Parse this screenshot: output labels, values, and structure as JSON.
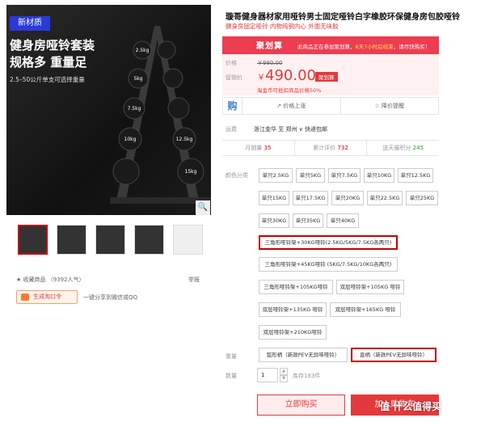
{
  "hero": {
    "badge": "新材质",
    "title": "健身房哑铃套装 规格多 重量足",
    "subtitle": "2.5–50公斤单支可选择重量",
    "dumbbell_labels": [
      "2.5kg",
      "5kg",
      "7.5kg",
      "10kg",
      "12.5kg",
      "15kg"
    ]
  },
  "actions": {
    "favorite": "收藏商品 （9392人气）",
    "report": "举报",
    "share_button": "生成淘口令",
    "share_text": "一键分享到微信或QQ"
  },
  "product": {
    "title": "璇哥健身器材家用哑铃男士固定哑铃白字橡胶环保健身房包胶哑铃",
    "subtitle": "健身房固定哑铃 内物纯钢内心 外面无味胶"
  },
  "promo": {
    "logo": "聚划算",
    "text_prefix": "此商品正在参加聚划算，",
    "text_highlight": "6天7小时后结束",
    "text_suffix": "，请尽快购买！"
  },
  "price": {
    "orig_label": "价格",
    "orig_value": "￥980.00",
    "promo_label": "促销价",
    "currency": "￥",
    "promo_value": "490.00",
    "promo_tag": "聚划算",
    "note": "淘金币可抵扣商品价格50%"
  },
  "tools": {
    "buy_icon": "购",
    "price_alert": "价格上涨",
    "price_drop": "降价提醒"
  },
  "shipping": {
    "label": "运费",
    "text": "浙江金华 至 郑州 ∨ 快递包邮"
  },
  "stats": {
    "monthly_label": "月销量",
    "monthly_value": "35",
    "reviews_label": "累计评价",
    "reviews_value": "732",
    "points_label": "送天猫积分",
    "points_value": "245"
  },
  "color": {
    "label": "颜色分类",
    "options": [
      "单只2.5KG",
      "单只5KG",
      "单只7.5KG",
      "单只10KG",
      "单只12.5KG",
      "单只15KG",
      "单只17.5KG",
      "单只20KG",
      "单只22.5KG",
      "单只25KG",
      "单只30KG",
      "单只35KG",
      "单只40KG",
      "三角形哑铃架+30KG哑铃(2.5KG/5KG/7.5KG各两只)",
      "三角形哑铃架+45KG哑铃 (5KG/7.5KG/10KG各两只)",
      "三角形哑铃架+105KG哑铃",
      "双层哑铃架+105KG 哑铃",
      "双层哑铃架+135KG 哑铃",
      "双层哑铃架+165KG 哑铃",
      "双层哑铃架+210KG哑铃"
    ]
  },
  "weight": {
    "label": "重量",
    "options": [
      "弧形柄（新款PEV无异味哑铃）",
      "直柄（新款PEV无异味哑铃）"
    ]
  },
  "quantity": {
    "label": "数量",
    "value": "1",
    "stock": "库存183件"
  },
  "buttons": {
    "buy_now": "立即购买",
    "add_cart": "加入购物车"
  },
  "watermark": "值 什么值得买",
  "colors": {
    "accent": "#e4393c",
    "promo_bar": "#ec3d51",
    "selected_border": "#c40000"
  }
}
